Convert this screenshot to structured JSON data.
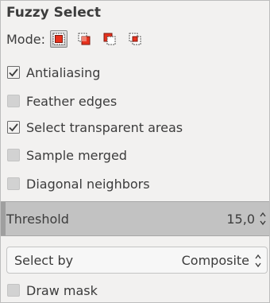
{
  "tool": {
    "title": "Fuzzy Select",
    "mode_label": "Mode:",
    "modes": [
      {
        "icon": "replace-selection-icon",
        "active": true
      },
      {
        "icon": "add-to-selection-icon",
        "active": false
      },
      {
        "icon": "subtract-from-selection-icon",
        "active": false
      },
      {
        "icon": "intersect-selection-icon",
        "active": false
      }
    ]
  },
  "options": {
    "antialiasing": {
      "label": "Antialiasing",
      "checked": true
    },
    "feather_edges": {
      "label": "Feather edges",
      "checked": false
    },
    "select_transparent": {
      "label": "Select transparent areas",
      "checked": true
    },
    "sample_merged": {
      "label": "Sample merged",
      "checked": false
    },
    "diagonal_neighbors": {
      "label": "Diagonal neighbors",
      "checked": false
    },
    "draw_mask": {
      "label": "Draw mask",
      "checked": false
    }
  },
  "threshold": {
    "label": "Threshold",
    "value": "15,0"
  },
  "select_by": {
    "label": "Select by",
    "value": "Composite"
  },
  "colors": {
    "accent_red": "#e8321e",
    "check": "#3c3c3c",
    "slider_bg": "#c2c2c2"
  }
}
